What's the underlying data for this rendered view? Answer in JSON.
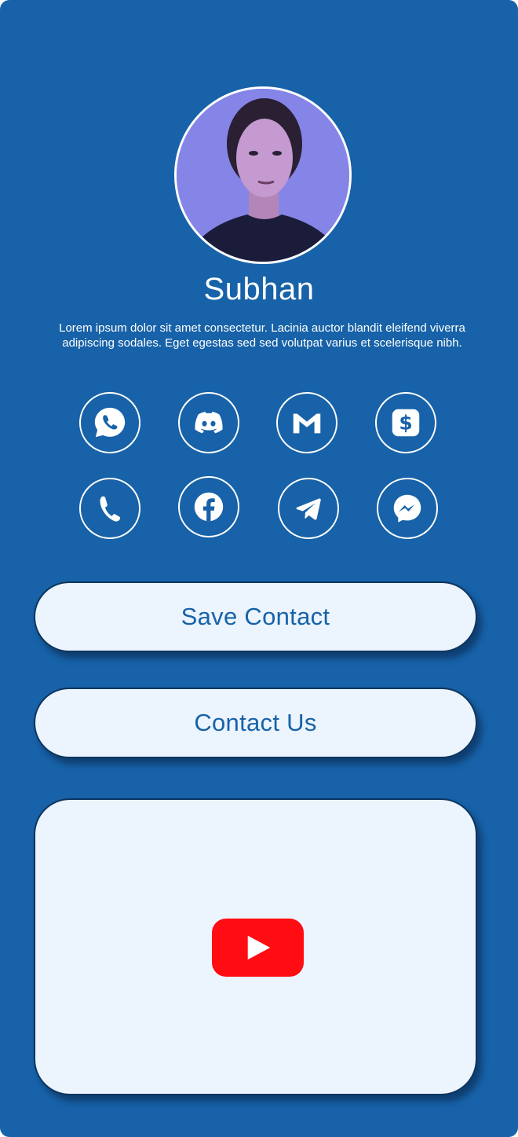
{
  "profile": {
    "name": "Subhan",
    "bio": "Lorem ipsum dolor sit amet consectetur. Lacinia auctor blandit eleifend viverra adipiscing sodales. Eget egestas sed sed volutpat varius et scelerisque nibh."
  },
  "social": [
    {
      "icon": "whatsapp-icon"
    },
    {
      "icon": "discord-icon"
    },
    {
      "icon": "gmail-icon"
    },
    {
      "icon": "cash-app-icon"
    },
    {
      "icon": "phone-icon"
    },
    {
      "icon": "facebook-icon"
    },
    {
      "icon": "telegram-icon"
    },
    {
      "icon": "messenger-icon"
    }
  ],
  "buttons": {
    "save_contact": "Save Contact",
    "contact_us": "Contact Us"
  },
  "video": {
    "icon": "youtube-play-icon"
  },
  "colors": {
    "background": "#1762a8",
    "button_fill": "#ecf4fd",
    "button_border": "#0d3560",
    "youtube_red": "#ff0d12"
  }
}
